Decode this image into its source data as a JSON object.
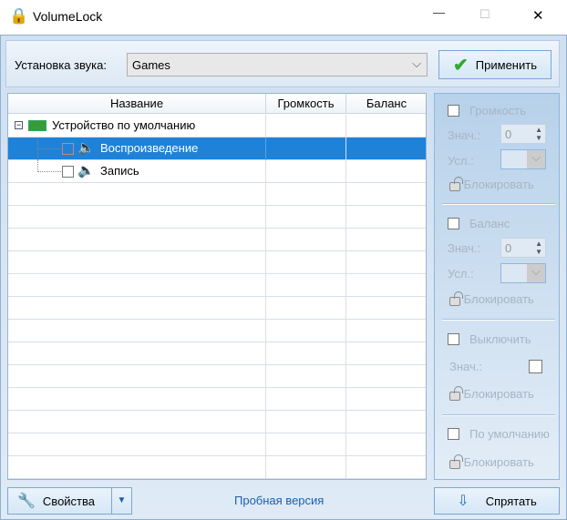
{
  "window": {
    "title": "VolumeLock",
    "minimize": "—",
    "maximize": "☐",
    "close": "✕"
  },
  "toolbar": {
    "preset_label": "Установка звука:",
    "preset_value": "Games",
    "apply_label": "Применить"
  },
  "tree": {
    "columns": [
      "Название",
      "Громкость",
      "Баланс"
    ],
    "items": [
      {
        "label": "Устройство по умолчанию",
        "level": 0,
        "selected": false
      },
      {
        "label": "Воспроизведение",
        "level": 1,
        "selected": true
      },
      {
        "label": "Запись",
        "level": 1,
        "selected": false
      }
    ]
  },
  "panel": {
    "volume": {
      "label": "Громкость",
      "value_label": "Знач.:",
      "value": "0",
      "cond_label": "Усл.:",
      "lock_label": "Блокировать"
    },
    "balance": {
      "label": "Баланс",
      "value_label": "Знач.:",
      "value": "0",
      "cond_label": "Усл.:",
      "lock_label": "Блокировать"
    },
    "mute": {
      "label": "Выключить",
      "value_label": "Знач.:",
      "lock_label": "Блокировать"
    },
    "default": {
      "label": "По умолчанию",
      "lock_label": "Блокировать"
    }
  },
  "footer": {
    "properties_label": "Свойства",
    "trial_label": "Пробная версия",
    "hide_label": "Спрятать"
  },
  "colors": {
    "selection": "#1e82d9",
    "trial_link": "#1a5fb4"
  }
}
